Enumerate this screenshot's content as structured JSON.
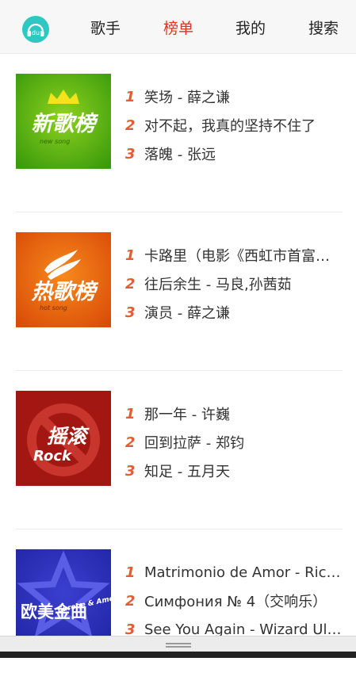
{
  "header": {
    "logo_text": "du",
    "nav": [
      "歌手",
      "榜单",
      "我的",
      "搜索"
    ],
    "active_index": 1,
    "accent_color": "#e0341e",
    "logo_color": "#2ec7c1"
  },
  "charts": [
    {
      "cover_title": "新歌榜",
      "cover_sub": "new song",
      "cover_icon": "crown-icon",
      "songs": [
        {
          "rank": "1",
          "title": "笑场 - 薛之谦"
        },
        {
          "rank": "2",
          "title": "对不起，我真的坚持不住了"
        },
        {
          "rank": "3",
          "title": "落魄 - 张远"
        }
      ]
    },
    {
      "cover_title": "热歌榜",
      "cover_sub": "hot song",
      "cover_icon": "flame-icon",
      "songs": [
        {
          "rank": "1",
          "title": "卡路里（电影《西虹市首富》插曲）"
        },
        {
          "rank": "2",
          "title": "往后余生 - 马良,孙茜茹"
        },
        {
          "rank": "3",
          "title": "演员 - 薛之谦"
        }
      ]
    },
    {
      "cover_title": "摇滚",
      "cover_sub": "Rock",
      "cover_icon": "no-sign-icon",
      "songs": [
        {
          "rank": "1",
          "title": "那一年 - 许巍"
        },
        {
          "rank": "2",
          "title": "回到拉萨 - 郑钧"
        },
        {
          "rank": "3",
          "title": "知足 - 五月天"
        }
      ]
    },
    {
      "cover_title": "欧美金曲",
      "cover_sub": "Europe & America",
      "cover_icon": "star-icon",
      "songs": [
        {
          "rank": "1",
          "title": "Matrimonio de Amor - Richard Clayderman"
        },
        {
          "rank": "2",
          "title": "Симфония № 4（交响乐）"
        },
        {
          "rank": "3",
          "title": "See You Again - Wizard Ultra"
        }
      ]
    }
  ]
}
